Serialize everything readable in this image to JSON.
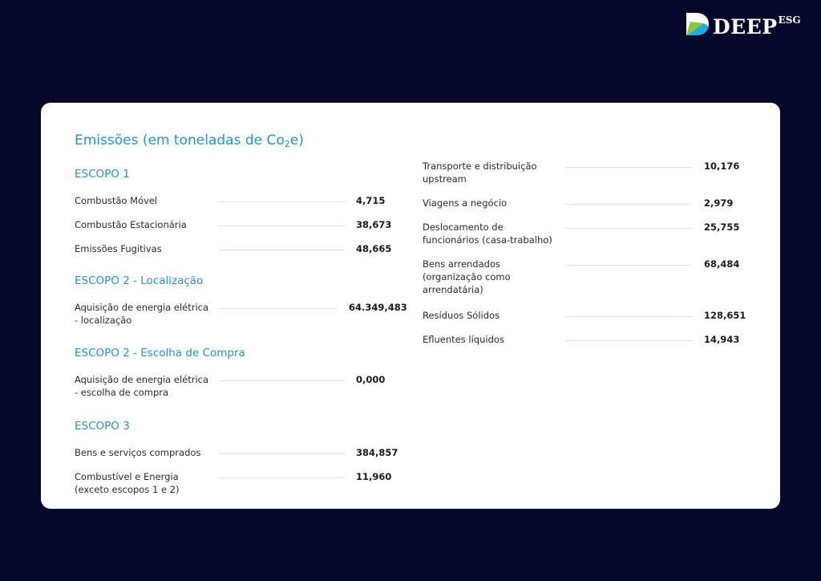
{
  "brand": {
    "name": "DEEP",
    "suffix": "ESG"
  },
  "title": {
    "prefix": "Emissões (em toneladas de Co",
    "sub": "2",
    "suffix": "e)"
  },
  "scope1": {
    "heading": "ESCOPO 1",
    "items": [
      {
        "label": "Combustão Móvel",
        "value": "4,715"
      },
      {
        "label": "Combustão Estacionária",
        "value": "38,673"
      },
      {
        "label": "Emissões Fugitivas",
        "value": "48,665"
      }
    ]
  },
  "scope2_loc": {
    "heading": "ESCOPO 2 - Localização",
    "items": [
      {
        "label": "Aquisição de energia elétrica - localização",
        "value": "64.349,483"
      }
    ]
  },
  "scope2_buy": {
    "heading": "ESCOPO 2 - Escolha de Compra",
    "items": [
      {
        "label": "Aquisição de energia elétrica - escolha de compra",
        "value": "0,000"
      }
    ]
  },
  "scope3": {
    "heading": "ESCOPO 3",
    "items": [
      {
        "label": "Bens e serviços comprados",
        "value": "384,857"
      },
      {
        "label": "Combustível e Energia (exceto escopos 1 e 2)",
        "value": "11,960"
      },
      {
        "label": "Transporte e distribuição upstream",
        "value": "10,176"
      },
      {
        "label": "Viagens a negócio",
        "value": "2,979"
      },
      {
        "label": "Deslocamento de funcionários (casa-trabalho)",
        "value": "25,755"
      },
      {
        "label": "Bens arrendados (organização como arrendatária)",
        "value": "68,484"
      },
      {
        "label": "Resíduos Sólidos",
        "value": "128,651"
      },
      {
        "label": "Efluentes líquidos",
        "value": "14,943"
      }
    ]
  }
}
